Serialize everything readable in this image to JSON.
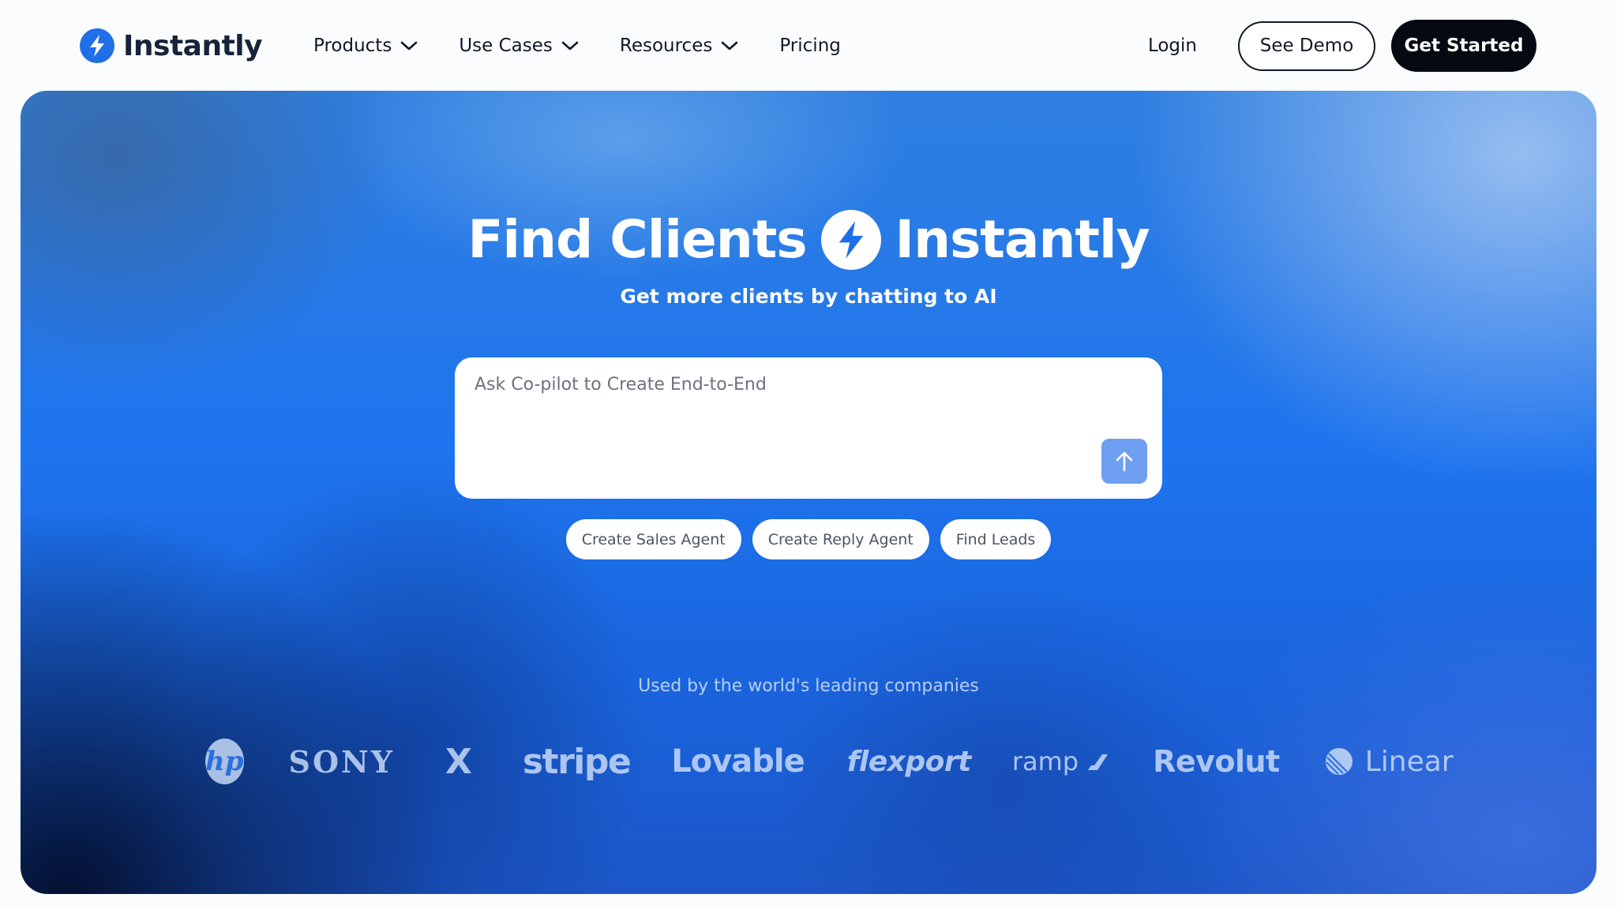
{
  "brand": {
    "name": "Instantly",
    "accent_color": "#1f6fe8",
    "logo_icon": "lightning-bolt-icon"
  },
  "nav": {
    "items": [
      {
        "label": "Products",
        "has_dropdown": true
      },
      {
        "label": "Use Cases",
        "has_dropdown": true
      },
      {
        "label": "Resources",
        "has_dropdown": true
      },
      {
        "label": "Pricing",
        "has_dropdown": false
      }
    ],
    "login_label": "Login",
    "demo_label": "See Demo",
    "start_label": "Get Started"
  },
  "hero": {
    "title_left": "Find Clients",
    "title_right": "Instantly",
    "subtitle": "Get more clients by chatting to AI",
    "prompt_placeholder": "Ask Co-pilot to Create End-to-End",
    "send_icon": "arrow-up-icon",
    "chips": [
      "Create Sales Agent",
      "Create Reply Agent",
      "Find Leads"
    ],
    "used_by_label": "Used by the world's leading companies",
    "companies": [
      {
        "name": "hp",
        "display": "hp"
      },
      {
        "name": "sony",
        "display": "SONY"
      },
      {
        "name": "x",
        "display": "X"
      },
      {
        "name": "stripe",
        "display": "stripe"
      },
      {
        "name": "lovable",
        "display": "Lovable"
      },
      {
        "name": "flexport",
        "display": "flexport"
      },
      {
        "name": "ramp",
        "display": "ramp"
      },
      {
        "name": "revolut",
        "display": "Revolut"
      },
      {
        "name": "linear",
        "display": "Linear"
      }
    ]
  }
}
